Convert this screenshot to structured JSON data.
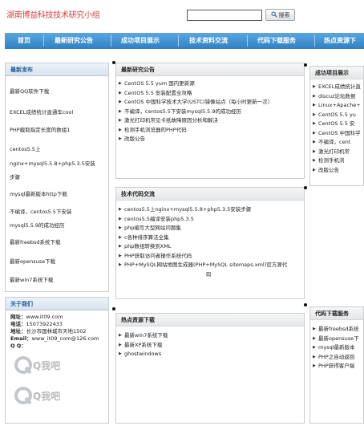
{
  "header": {
    "site_title": "湖南博益科技技术研究小组",
    "search_button": "搜索",
    "search_value": ""
  },
  "nav": [
    "首页",
    "最新研究公告",
    "成功项目展示",
    "技术资料交流",
    "代码下载服务",
    "热点资源下"
  ],
  "left": {
    "latest": {
      "title": "最新发布",
      "items": [
        "最新QQ软件下载",
        "EXCEL成绩统计直通车cool",
        "PHP截取指定长度的数组1",
        "centos5.5上",
        "nginx+mysql5.5.8+php5.3.5安装",
        "步骤",
        "mysql最新版本http下载",
        "不编译，centos5.5下安装",
        "mysql5.5.9的成功经历",
        "最新freebsd系统下载",
        "最新opensuse下载",
        "最新win7系统下载"
      ]
    },
    "about": {
      "title": "关于我们",
      "website_label": "网址：",
      "website": "www.it09.com",
      "phone_label": "电话：",
      "phone": "15073922433",
      "address_label": "地址：",
      "address": "长沙市国林城市天地1502",
      "email_label": "Email：",
      "email": "www_it09_com@126.com",
      "qq_label": "Q Q：",
      "qq_logo_text": "Q我吧"
    }
  },
  "center": {
    "announcements": {
      "title": "最新研究公告",
      "items": [
        "CentOS 5.5 yum 国内更新源",
        "CentOS 5.5 安装配置全攻略",
        "CentOS 中国科学技术大学(USTC)镜像站点（每小时更新一次）",
        "不编译，centos5.5下安装mysql5.5.9的成功经历",
        "激光打印机常见卡纸故障原因分析和解决",
        "检测手机浏览器的PHP代码",
        "改版公告"
      ]
    },
    "tech": {
      "title": "技术代码交流",
      "items": [
        "centos5.5上nginx+mysql5.5.8+php5.3.5安装步骤",
        "centos5.5编译安装php5.3.5",
        "php编写大型网站问题集",
        "c各种排序算法全集",
        "php数组转换到XML",
        "PHP获取访问者操作系统代码",
        "PHP+MySQL网站地图生成器(PHP+MySQL sitemaps.xml)官方源代",
        "码"
      ]
    },
    "hot": {
      "title": "热点资源下载",
      "items": [
        "最新win7系统下载",
        "最新XP系统下载",
        "ghostwindows"
      ]
    }
  },
  "right": {
    "projects": {
      "title": "成功项目展示",
      "items": [
        "EXCEL成绩统计直",
        "discuz论坛数据",
        "Linux+Apache+",
        "CentOS 5.5 yu",
        "CentOS 5.5 安",
        "CentOS 中国科学",
        "不编译，cent",
        "激光打印机常",
        "检测手机浏",
        "改版公告"
      ]
    },
    "downloads": {
      "title": "代码下载服务",
      "items": [
        "最新freebsd系统",
        "最新opensuse下",
        "mysql最新版本",
        "PHP之自动返回",
        "PHP获得客户端"
      ]
    }
  }
}
